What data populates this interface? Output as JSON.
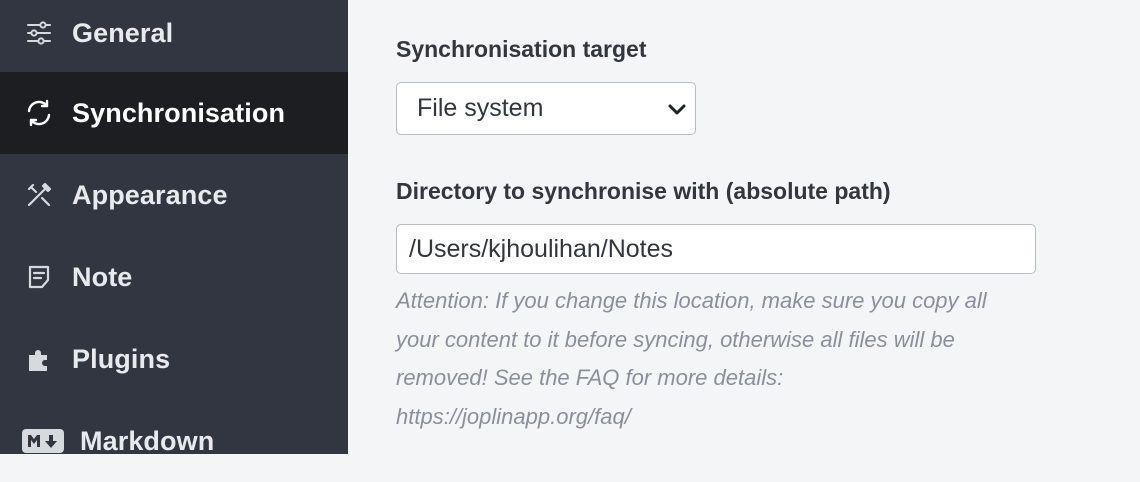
{
  "sidebar": {
    "items": [
      {
        "label": "General",
        "icon": "sliders-icon",
        "selected": false
      },
      {
        "label": "Synchronisation",
        "icon": "sync-icon",
        "selected": true
      },
      {
        "label": "Appearance",
        "icon": "paint-brush-icon",
        "selected": false
      },
      {
        "label": "Note",
        "icon": "note-icon",
        "selected": false
      },
      {
        "label": "Plugins",
        "icon": "puzzle-icon",
        "selected": false
      },
      {
        "label": "Markdown",
        "icon": "markdown-icon",
        "selected": false
      }
    ]
  },
  "main": {
    "sync_target": {
      "label": "Synchronisation target",
      "value": "File system"
    },
    "directory": {
      "label": "Directory to synchronise with (absolute path)",
      "value": "/Users/kjhoulihan/Notes",
      "help_lines": [
        "Attention: If you change this location, make sure you copy all",
        "your content to it before syncing, otherwise all files will be",
        "removed! See the FAQ for more details:",
        "https://joplinapp.org/faq/"
      ]
    }
  },
  "colors": {
    "sidebar_bg": "#313640",
    "sidebar_selected_bg": "#1c1e22",
    "main_bg": "#f4f5f6",
    "help_text": "#8a909a"
  }
}
